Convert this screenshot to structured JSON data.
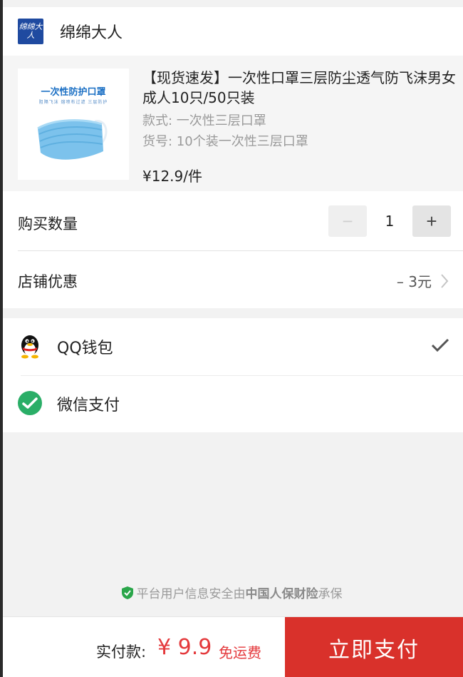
{
  "shop": {
    "logo_text": "绵绵大人",
    "name": "绵绵大人"
  },
  "product": {
    "image_title": "一次性防护口罩",
    "image_subtitle": "阻隔飞沫 熔喷布过滤 三层防护",
    "title": "【现货速发】一次性口罩三层防尘透气防飞沫男女成人10只/50只装",
    "style": "款式: 一次性三层口罩",
    "sku": "货号: 10个装一次性三层口罩",
    "price": "¥12.9/件"
  },
  "quantity": {
    "label": "购买数量",
    "value": "1",
    "minus": "−",
    "plus": "+"
  },
  "discount": {
    "label": "店铺优惠",
    "value": "– 3元"
  },
  "payment": {
    "options": [
      {
        "label": "QQ钱包",
        "icon": "qq-penguin-icon",
        "selected": true
      },
      {
        "label": "微信支付",
        "icon": "wechat-icon",
        "selected": false
      }
    ]
  },
  "security": {
    "prefix": "平台用户信息安全由",
    "insurer": "中国人保财险",
    "suffix": "承保"
  },
  "footer": {
    "total_label": "实付款:",
    "total_amount": "¥ 9.9",
    "shipping": "免运费",
    "pay_button": "立即支付"
  },
  "colors": {
    "accent": "#d9312b",
    "price_red": "#e4393c",
    "wechat_green": "#2aae67",
    "shop_logo_blue": "#1f4aa0"
  }
}
